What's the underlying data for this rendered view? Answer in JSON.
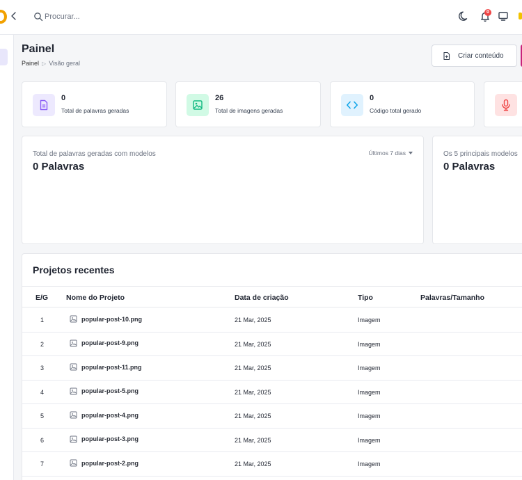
{
  "search": {
    "placeholder": "Procurar..."
  },
  "notifications": {
    "count": "0"
  },
  "header": {
    "title": "Painel",
    "breadcrumb": [
      "Painel",
      "Visão geral"
    ],
    "create_button": "Criar conteúdo"
  },
  "stats": [
    {
      "value": "0",
      "label": "Total de palavras geradas",
      "icon": "document-icon",
      "color": "#8b5cf6",
      "bg": "#ede9fe"
    },
    {
      "value": "26",
      "label": "Total de imagens geradas",
      "icon": "image-icon",
      "color": "#10b981",
      "bg": "#d1fae5"
    },
    {
      "value": "0",
      "label": "Código total gerado",
      "icon": "code-icon",
      "color": "#0ea5e9",
      "bg": "#e0f2fe"
    },
    {
      "value": "",
      "label": "",
      "icon": "microphone-icon",
      "color": "#ef4444",
      "bg": "#fee2e2"
    }
  ],
  "panels": {
    "words": {
      "subtitle": "Total de palavras geradas com modelos",
      "value": "0 Palavras",
      "range": "Últimos 7 dias"
    },
    "top_models": {
      "subtitle": "Os 5 principais modelos",
      "value": "0 Palavras"
    }
  },
  "projects": {
    "title": "Projetos recentes",
    "columns": [
      "E/G",
      "Nome do Projeto",
      "Data de criação",
      "Tipo",
      "Palavras/Tamanho"
    ],
    "rows": [
      {
        "num": "1",
        "name": "popular-post-10.png",
        "date": "21 Mar, 2025",
        "type": "Imagem"
      },
      {
        "num": "2",
        "name": "popular-post-9.png",
        "date": "21 Mar, 2025",
        "type": "Imagem"
      },
      {
        "num": "3",
        "name": "popular-post-11.png",
        "date": "21 Mar, 2025",
        "type": "Imagem"
      },
      {
        "num": "4",
        "name": "popular-post-5.png",
        "date": "21 Mar, 2025",
        "type": "Imagem"
      },
      {
        "num": "5",
        "name": "popular-post-4.png",
        "date": "21 Mar, 2025",
        "type": "Imagem"
      },
      {
        "num": "6",
        "name": "popular-post-3.png",
        "date": "21 Mar, 2025",
        "type": "Imagem"
      },
      {
        "num": "7",
        "name": "popular-post-2.png",
        "date": "21 Mar, 2025",
        "type": "Imagem"
      }
    ]
  }
}
